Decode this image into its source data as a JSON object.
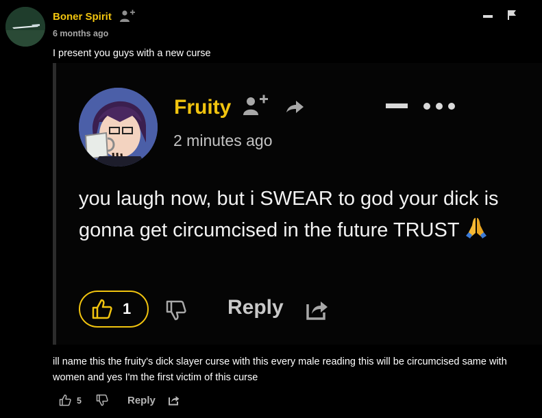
{
  "comment": {
    "author": "Boner Spirit",
    "time": "6 months ago",
    "text": "I present you guys with a new curse",
    "body": "ill name this the fruity's dick slayer curse with this every male reading this will be circumcised same with women and yes I'm the first victim of this curse",
    "likes": "5",
    "reply_label": "Reply",
    "icons": {
      "follow": "add-user-icon",
      "collapse": "minus-icon",
      "report": "flag-icon",
      "like": "thumbs-up-icon",
      "dislike": "thumbs-down-icon",
      "share": "share-icon"
    }
  },
  "embedded": {
    "author": "Fruity",
    "time": "2 minutes ago",
    "text": "you laugh now, but i SWEAR to god your dick is gonna get circumcised in the future TRUST",
    "likes": "1",
    "reply_label": "Reply",
    "icons": {
      "follow": "add-user-icon",
      "share": "arrow-icon",
      "collapse": "minus-icon",
      "more": "more-dots-icon",
      "emoji": "praying-hands-icon"
    }
  },
  "colors": {
    "background": "#000000",
    "username": "#f1c40f",
    "like_outline": "#f1c40f"
  }
}
